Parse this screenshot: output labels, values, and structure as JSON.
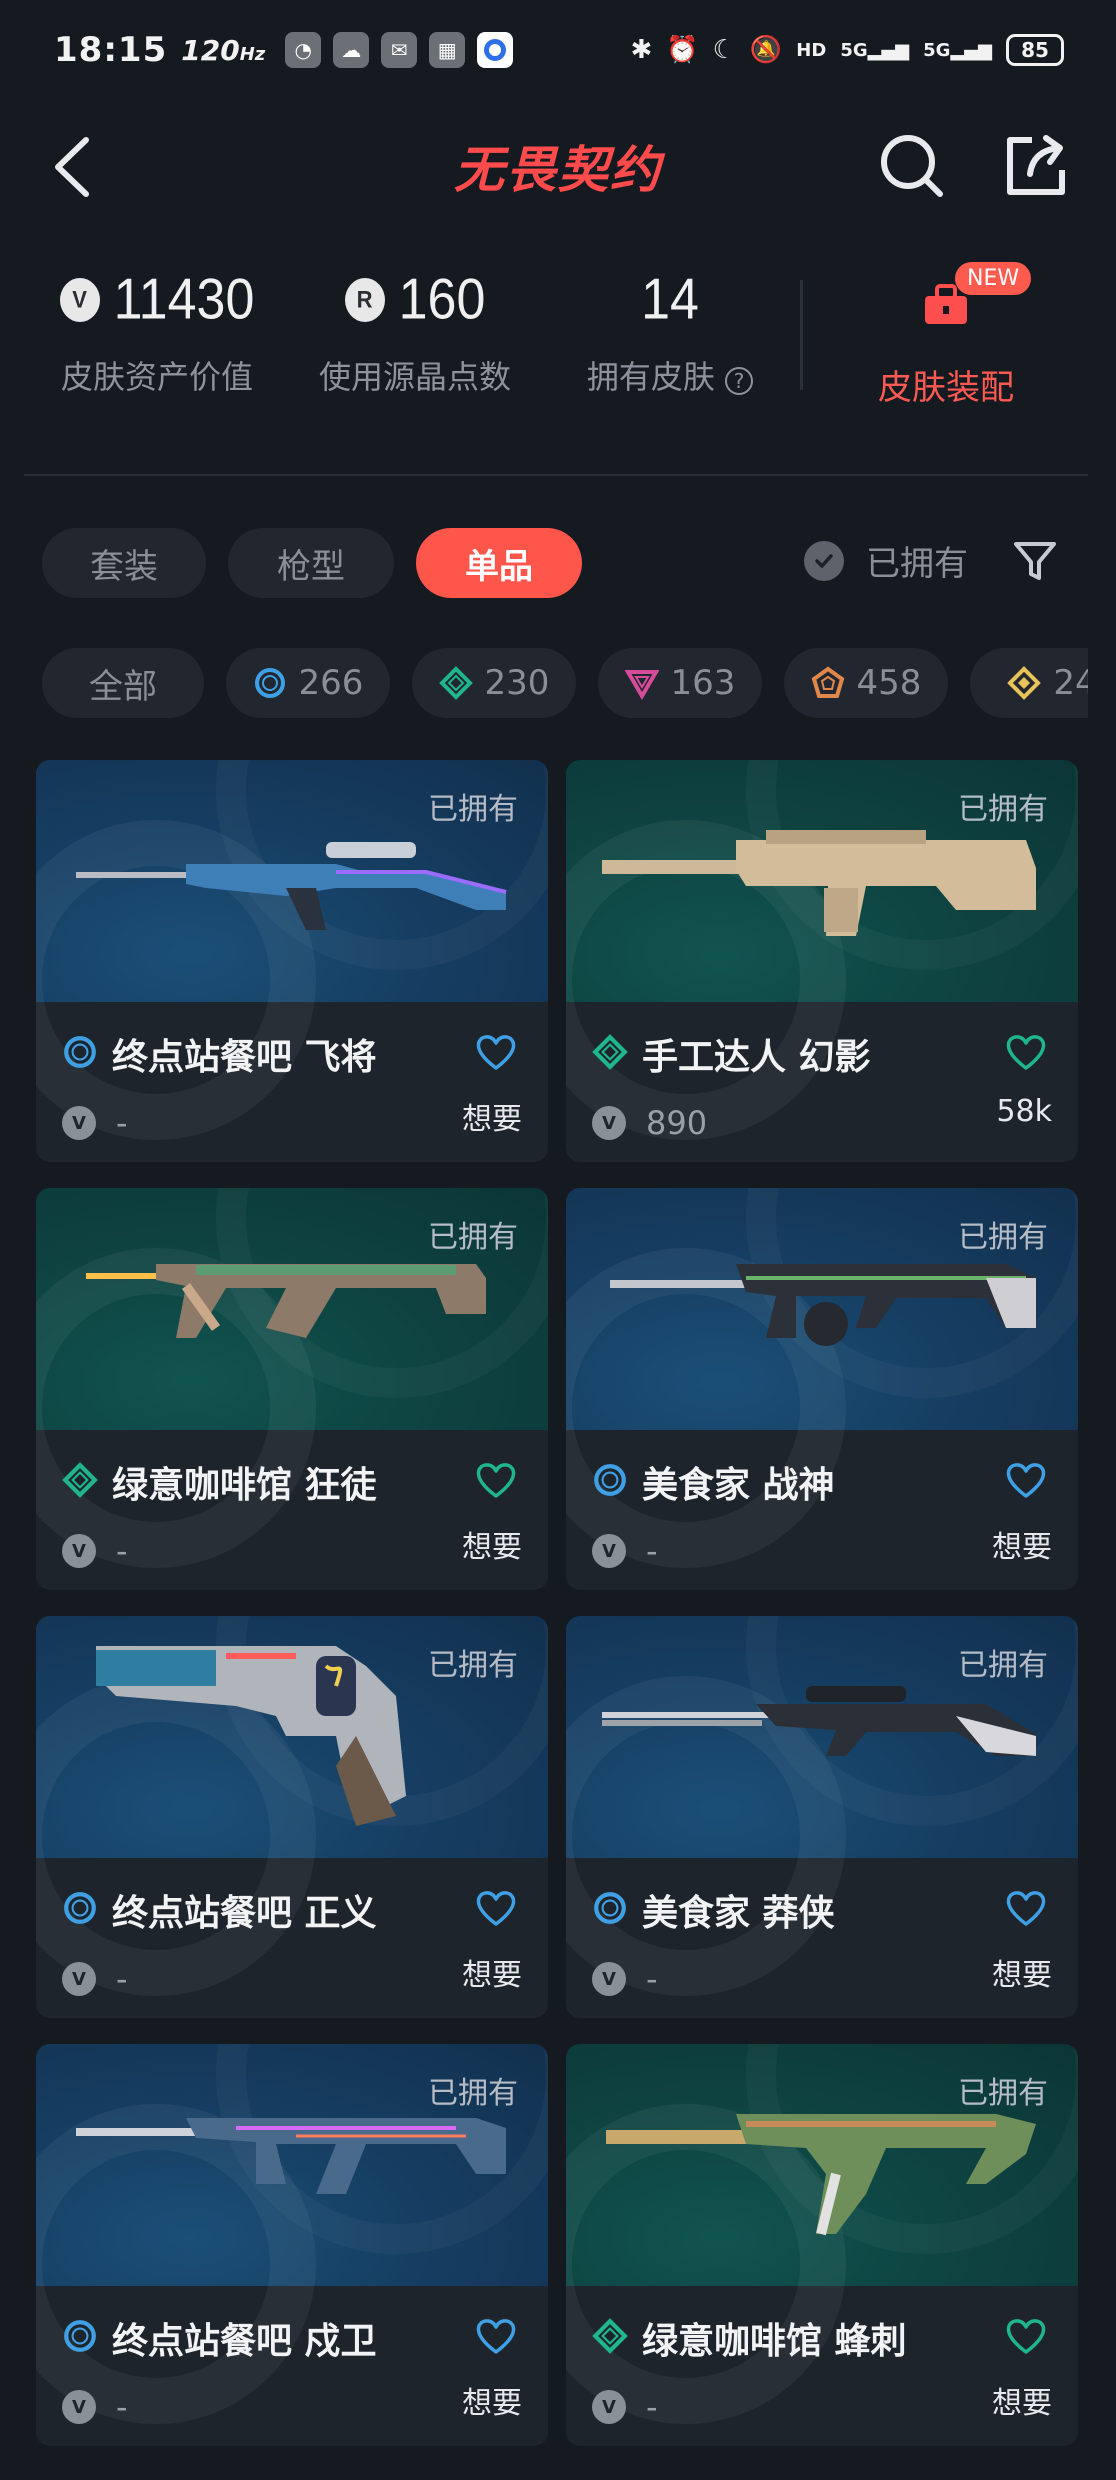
{
  "status_bar": {
    "time": "18:15",
    "refresh": "120",
    "refresh_unit": "Hz",
    "signal1": "5G",
    "signal2": "5G",
    "battery": "85"
  },
  "header": {
    "title": "无畏契约"
  },
  "stats": {
    "asset_value": "11430",
    "asset_label": "皮肤资产价值",
    "points_used": "160",
    "points_label": "使用源晶点数",
    "owned": "14",
    "owned_label": "拥有皮肤",
    "outfit_label": "皮肤装配",
    "new_badge": "NEW"
  },
  "tabs": [
    "套装",
    "枪型",
    "单品"
  ],
  "owned_toggle": "已拥有",
  "rarity_filters": [
    {
      "label": "全部"
    },
    {
      "count": "266",
      "tier": "select",
      "color": "#3fa0e6"
    },
    {
      "count": "230",
      "tier": "deluxe",
      "color": "#1fb58e"
    },
    {
      "count": "163",
      "tier": "premium",
      "color": "#d64c9a"
    },
    {
      "count": "458",
      "tier": "exclusive",
      "color": "#e0884a"
    },
    {
      "count": "24",
      "tier": "ultra",
      "color": "#e8c35a"
    }
  ],
  "cards": [
    {
      "name": "终点站餐吧 飞将",
      "price": "-",
      "want": "想要",
      "owned": "已拥有",
      "tier": "select",
      "tier_color": "#3fa0e6",
      "bg": "blue",
      "gun": "sniper"
    },
    {
      "name": "手工达人 幻影",
      "price": "890",
      "want": "58k",
      "owned": "已拥有",
      "tier": "deluxe",
      "tier_color": "#1fb58e",
      "bg": "green",
      "gun": "rifle"
    },
    {
      "name": "绿意咖啡馆 狂徒",
      "price": "-",
      "want": "想要",
      "owned": "已拥有",
      "tier": "deluxe",
      "tier_color": "#1fb58e",
      "bg": "green",
      "gun": "smg"
    },
    {
      "name": "美食家 战神",
      "price": "-",
      "want": "想要",
      "owned": "已拥有",
      "tier": "select",
      "tier_color": "#3fa0e6",
      "bg": "blue",
      "gun": "lmg"
    },
    {
      "name": "终点站餐吧 正义",
      "price": "-",
      "want": "想要",
      "owned": "已拥有",
      "tier": "select",
      "tier_color": "#3fa0e6",
      "bg": "blue",
      "gun": "revolver"
    },
    {
      "name": "美食家 莽侠",
      "price": "-",
      "want": "想要",
      "owned": "已拥有",
      "tier": "select",
      "tier_color": "#3fa0e6",
      "bg": "blue",
      "gun": "marshal"
    },
    {
      "name": "终点站餐吧 戍卫",
      "price": "-",
      "want": "想要",
      "owned": "已拥有",
      "tier": "select",
      "tier_color": "#3fa0e6",
      "bg": "blue",
      "gun": "guardian"
    },
    {
      "name": "绿意咖啡馆 蜂刺",
      "price": "-",
      "want": "想要",
      "owned": "已拥有",
      "tier": "deluxe",
      "tier_color": "#1fb58e",
      "bg": "green",
      "gun": "spectre"
    }
  ]
}
